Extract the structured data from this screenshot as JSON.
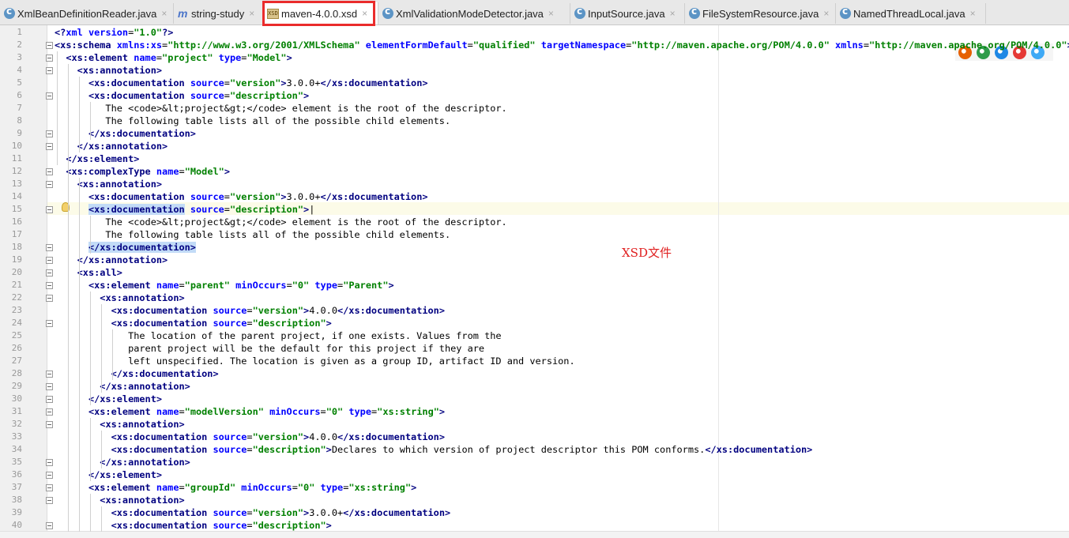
{
  "tabs": [
    {
      "label": "XmlBeanDefinitionReader.java",
      "icon": "class-icon",
      "active": false
    },
    {
      "label": "string-study",
      "icon": "maven-icon",
      "active": false
    },
    {
      "label": "maven-4.0.0.xsd",
      "icon": "xsd-icon",
      "active": true
    },
    {
      "label": "XmlValidationModeDetector.java",
      "icon": "class-icon",
      "active": false
    },
    {
      "label": "InputSource.java",
      "icon": "class-icon",
      "active": false
    },
    {
      "label": "FileSystemResource.java",
      "icon": "class-icon",
      "active": false
    },
    {
      "label": "NamedThreadLocal.java",
      "icon": "class-icon",
      "active": false
    }
  ],
  "close_glyph": "×",
  "annotation_text": "XSD文件",
  "highlight_color": "#ea2c2c",
  "current_line": 15,
  "browser_icons": [
    "firefox-icon",
    "chrome-icon",
    "safari-icon",
    "opera-icon",
    "ie-icon"
  ],
  "lines": [
    [
      [
        "t",
        "<?"
      ],
      [
        "a",
        "xml "
      ],
      [
        "a",
        "version"
      ],
      [
        "x",
        "="
      ],
      [
        "v",
        "\"1.0\""
      ],
      [
        "t",
        "?>"
      ]
    ],
    [
      [
        "t",
        "<xs:schema "
      ],
      [
        "a",
        "xmlns:xs"
      ],
      [
        "x",
        "="
      ],
      [
        "v",
        "\"http://www.w3.org/2001/XMLSchema\""
      ],
      [
        "x",
        " "
      ],
      [
        "a",
        "elementFormDefault"
      ],
      [
        "x",
        "="
      ],
      [
        "v",
        "\"qualified\""
      ],
      [
        "x",
        " "
      ],
      [
        "a",
        "targetNamespace"
      ],
      [
        "x",
        "="
      ],
      [
        "v",
        "\"http://maven.apache.org/POM/4.0.0\""
      ],
      [
        "x",
        " "
      ],
      [
        "a",
        "xmlns"
      ],
      [
        "x",
        "="
      ],
      [
        "v",
        "\"http://maven.apache.org/POM/4.0.0\""
      ],
      [
        "t",
        ">"
      ]
    ],
    [
      [
        "x",
        "  "
      ],
      [
        "t",
        "<xs:element "
      ],
      [
        "a",
        "name"
      ],
      [
        "x",
        "="
      ],
      [
        "v",
        "\"project\""
      ],
      [
        "x",
        " "
      ],
      [
        "a",
        "type"
      ],
      [
        "x",
        "="
      ],
      [
        "v",
        "\"Model\""
      ],
      [
        "t",
        ">"
      ]
    ],
    [
      [
        "x",
        "    "
      ],
      [
        "t",
        "<xs:annotation>"
      ]
    ],
    [
      [
        "x",
        "      "
      ],
      [
        "t",
        "<xs:documentation "
      ],
      [
        "a",
        "source"
      ],
      [
        "x",
        "="
      ],
      [
        "v",
        "\"version\""
      ],
      [
        "t",
        ">"
      ],
      [
        "x",
        "3.0.0+"
      ],
      [
        "t",
        "</xs:documentation>"
      ]
    ],
    [
      [
        "x",
        "      "
      ],
      [
        "t",
        "<xs:documentation "
      ],
      [
        "a",
        "source"
      ],
      [
        "x",
        "="
      ],
      [
        "v",
        "\"description\""
      ],
      [
        "t",
        ">"
      ]
    ],
    [
      [
        "x",
        "         The <code>&lt;project&gt;</code> element is the root of the descriptor."
      ]
    ],
    [
      [
        "x",
        "         The following table lists all of the possible child elements."
      ]
    ],
    [
      [
        "x",
        "      "
      ],
      [
        "t",
        "</xs:documentation>"
      ]
    ],
    [
      [
        "x",
        "    "
      ],
      [
        "t",
        "</xs:annotation>"
      ]
    ],
    [
      [
        "x",
        "  "
      ],
      [
        "t",
        "</xs:element>"
      ]
    ],
    [
      [
        "x",
        "  "
      ],
      [
        "t",
        "<xs:complexType "
      ],
      [
        "a",
        "name"
      ],
      [
        "x",
        "="
      ],
      [
        "v",
        "\"Model\""
      ],
      [
        "t",
        ">"
      ]
    ],
    [
      [
        "x",
        "    "
      ],
      [
        "t",
        "<xs:annotation>"
      ]
    ],
    [
      [
        "x",
        "      "
      ],
      [
        "t",
        "<xs:documentation "
      ],
      [
        "a",
        "source"
      ],
      [
        "x",
        "="
      ],
      [
        "v",
        "\"version\""
      ],
      [
        "t",
        ">"
      ],
      [
        "x",
        "3.0.0+"
      ],
      [
        "t",
        "</xs:documentation>"
      ]
    ],
    [
      [
        "x",
        "      "
      ],
      [
        "ts",
        "<xs:documentation"
      ],
      [
        "t",
        " "
      ],
      [
        "a",
        "source"
      ],
      [
        "x",
        "="
      ],
      [
        "v",
        "\"description\""
      ],
      [
        "t",
        ">"
      ],
      [
        "x",
        "|"
      ]
    ],
    [
      [
        "x",
        "         The <code>&lt;project&gt;</code> element is the root of the descriptor."
      ]
    ],
    [
      [
        "x",
        "         The following table lists all of the possible child elements."
      ]
    ],
    [
      [
        "x",
        "      "
      ],
      [
        "ts",
        "</xs:documentation>"
      ]
    ],
    [
      [
        "x",
        "    "
      ],
      [
        "t",
        "</xs:annotation>"
      ]
    ],
    [
      [
        "x",
        "    "
      ],
      [
        "t",
        "<xs:all>"
      ]
    ],
    [
      [
        "x",
        "      "
      ],
      [
        "t",
        "<xs:element "
      ],
      [
        "a",
        "name"
      ],
      [
        "x",
        "="
      ],
      [
        "v",
        "\"parent\""
      ],
      [
        "x",
        " "
      ],
      [
        "a",
        "minOccurs"
      ],
      [
        "x",
        "="
      ],
      [
        "v",
        "\"0\""
      ],
      [
        "x",
        " "
      ],
      [
        "a",
        "type"
      ],
      [
        "x",
        "="
      ],
      [
        "v",
        "\"Parent\""
      ],
      [
        "t",
        ">"
      ]
    ],
    [
      [
        "x",
        "        "
      ],
      [
        "t",
        "<xs:annotation>"
      ]
    ],
    [
      [
        "x",
        "          "
      ],
      [
        "t",
        "<xs:documentation "
      ],
      [
        "a",
        "source"
      ],
      [
        "x",
        "="
      ],
      [
        "v",
        "\"version\""
      ],
      [
        "t",
        ">"
      ],
      [
        "x",
        "4.0.0"
      ],
      [
        "t",
        "</xs:documentation>"
      ]
    ],
    [
      [
        "x",
        "          "
      ],
      [
        "t",
        "<xs:documentation "
      ],
      [
        "a",
        "source"
      ],
      [
        "x",
        "="
      ],
      [
        "v",
        "\"description\""
      ],
      [
        "t",
        ">"
      ]
    ],
    [
      [
        "x",
        "             The location of the parent project, if one exists. Values from the"
      ]
    ],
    [
      [
        "x",
        "             parent project will be the default for this project if they are"
      ]
    ],
    [
      [
        "x",
        "             left unspecified. The location is given as a group ID, artifact ID and version."
      ]
    ],
    [
      [
        "x",
        "          "
      ],
      [
        "t",
        "</xs:documentation>"
      ]
    ],
    [
      [
        "x",
        "        "
      ],
      [
        "t",
        "</xs:annotation>"
      ]
    ],
    [
      [
        "x",
        "      "
      ],
      [
        "t",
        "</xs:element>"
      ]
    ],
    [
      [
        "x",
        "      "
      ],
      [
        "t",
        "<xs:element "
      ],
      [
        "a",
        "name"
      ],
      [
        "x",
        "="
      ],
      [
        "v",
        "\"modelVersion\""
      ],
      [
        "x",
        " "
      ],
      [
        "a",
        "minOccurs"
      ],
      [
        "x",
        "="
      ],
      [
        "v",
        "\"0\""
      ],
      [
        "x",
        " "
      ],
      [
        "a",
        "type"
      ],
      [
        "x",
        "="
      ],
      [
        "v",
        "\"xs:string\""
      ],
      [
        "t",
        ">"
      ]
    ],
    [
      [
        "x",
        "        "
      ],
      [
        "t",
        "<xs:annotation>"
      ]
    ],
    [
      [
        "x",
        "          "
      ],
      [
        "t",
        "<xs:documentation "
      ],
      [
        "a",
        "source"
      ],
      [
        "x",
        "="
      ],
      [
        "v",
        "\"version\""
      ],
      [
        "t",
        ">"
      ],
      [
        "x",
        "4.0.0"
      ],
      [
        "t",
        "</xs:documentation>"
      ]
    ],
    [
      [
        "x",
        "          "
      ],
      [
        "t",
        "<xs:documentation "
      ],
      [
        "a",
        "source"
      ],
      [
        "x",
        "="
      ],
      [
        "v",
        "\"description\""
      ],
      [
        "t",
        ">"
      ],
      [
        "x",
        "Declares to which version of project descriptor this POM conforms."
      ],
      [
        "t",
        "</xs:documentation>"
      ]
    ],
    [
      [
        "x",
        "        "
      ],
      [
        "t",
        "</xs:annotation>"
      ]
    ],
    [
      [
        "x",
        "      "
      ],
      [
        "t",
        "</xs:element>"
      ]
    ],
    [
      [
        "x",
        "      "
      ],
      [
        "t",
        "<xs:element "
      ],
      [
        "a",
        "name"
      ],
      [
        "x",
        "="
      ],
      [
        "v",
        "\"groupId\""
      ],
      [
        "x",
        " "
      ],
      [
        "a",
        "minOccurs"
      ],
      [
        "x",
        "="
      ],
      [
        "v",
        "\"0\""
      ],
      [
        "x",
        " "
      ],
      [
        "a",
        "type"
      ],
      [
        "x",
        "="
      ],
      [
        "v",
        "\"xs:string\""
      ],
      [
        "t",
        ">"
      ]
    ],
    [
      [
        "x",
        "        "
      ],
      [
        "t",
        "<xs:annotation>"
      ]
    ],
    [
      [
        "x",
        "          "
      ],
      [
        "t",
        "<xs:documentation "
      ],
      [
        "a",
        "source"
      ],
      [
        "x",
        "="
      ],
      [
        "v",
        "\"version\""
      ],
      [
        "t",
        ">"
      ],
      [
        "x",
        "3.0.0+"
      ],
      [
        "t",
        "</xs:documentation>"
      ]
    ],
    [
      [
        "x",
        "          "
      ],
      [
        "t",
        "<xs:documentation "
      ],
      [
        "a",
        "source"
      ],
      [
        "x",
        "="
      ],
      [
        "v",
        "\"description\""
      ],
      [
        "t",
        ">"
      ]
    ]
  ],
  "fold_lines": [
    2,
    3,
    4,
    6,
    9,
    10,
    12,
    13,
    15,
    18,
    19,
    20,
    21,
    22,
    24,
    28,
    29,
    30,
    31,
    32,
    35,
    36,
    37,
    38,
    40
  ]
}
